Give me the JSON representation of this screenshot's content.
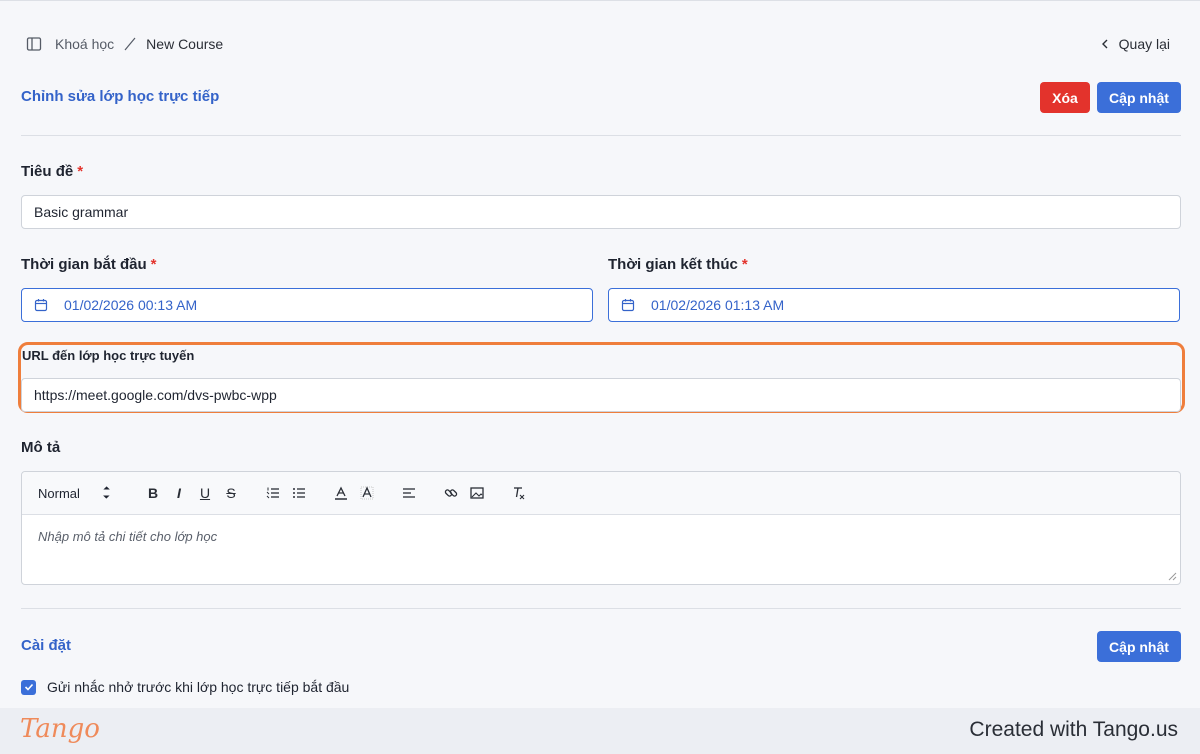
{
  "breadcrumb": {
    "parent": "Khoá học",
    "current": "New Course"
  },
  "back_label": "Quay lại",
  "header": {
    "title": "Chỉnh sửa lớp học trực tiếp",
    "delete_label": "Xóa",
    "update_label": "Cập nhật"
  },
  "form": {
    "title_label": "Tiêu đề",
    "title_value": "Basic grammar",
    "required_mark": "*",
    "start_label": "Thời gian bắt đầu",
    "start_value": "01/02/2026 00:13 AM",
    "end_label": "Thời gian kết thúc",
    "end_value": "01/02/2026 01:13 AM",
    "url_label": "URL đến lớp học trực tuyến",
    "url_value": "https://meet.google.com/dvs-pwbc-wpp",
    "desc_label": "Mô tả",
    "desc_placeholder": "Nhập mô tả chi tiết cho lớp học"
  },
  "editor": {
    "format_select": "Normal"
  },
  "settings": {
    "title": "Cài đặt",
    "update_label": "Cập nhật",
    "reminder_label": "Gửi nhắc nhở trước khi lớp học trực tiếp bắt đầu",
    "reminder_checked": true
  },
  "footer": {
    "brand": "Tango",
    "created_text": "Created with Tango.us"
  },
  "colors": {
    "accent": "#3b6fd9",
    "danger": "#e3332c",
    "highlight": "#ef7e3c"
  }
}
